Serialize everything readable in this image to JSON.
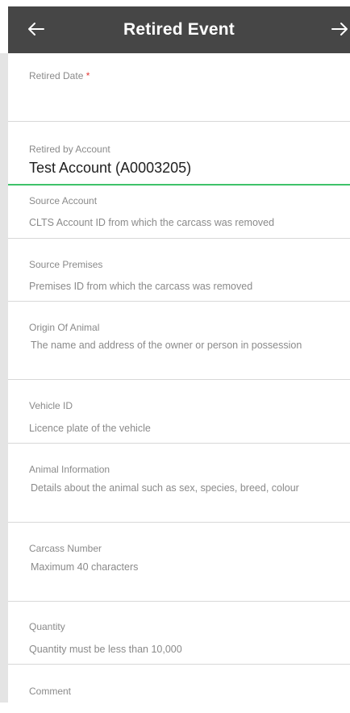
{
  "header": {
    "title": "Retired Event",
    "back_icon": "arrow-left-icon",
    "forward_icon": "arrow-right-icon"
  },
  "fields": {
    "retired_date": {
      "label": "Retired Date",
      "required_mark": "*"
    },
    "retired_by_account": {
      "label": "Retired by Account",
      "value": "Test Account (A0003205)"
    },
    "source_account": {
      "label": "Source Account",
      "placeholder": "CLTS Account ID from which the carcass was removed"
    },
    "source_premises": {
      "label": "Source Premises",
      "placeholder": "Premises ID from which the carcass was removed"
    },
    "origin_of_animal": {
      "label": "Origin Of Animal",
      "placeholder": "The name and address of the owner or person in possession"
    },
    "vehicle_id": {
      "label": "Vehicle ID",
      "placeholder": "Licence plate of the vehicle"
    },
    "animal_information": {
      "label": "Animal Information",
      "placeholder": "Details about the animal such as sex, species, breed, colour"
    },
    "carcass_number": {
      "label": "Carcass Number",
      "placeholder": "Maximum 40 characters"
    },
    "quantity": {
      "label": "Quantity",
      "placeholder": "Quantity must be less than 10,000"
    },
    "comment": {
      "label": "Comment"
    }
  },
  "colors": {
    "appbar": "#464646",
    "active_underline": "#3ec26a",
    "required": "#e53935"
  }
}
